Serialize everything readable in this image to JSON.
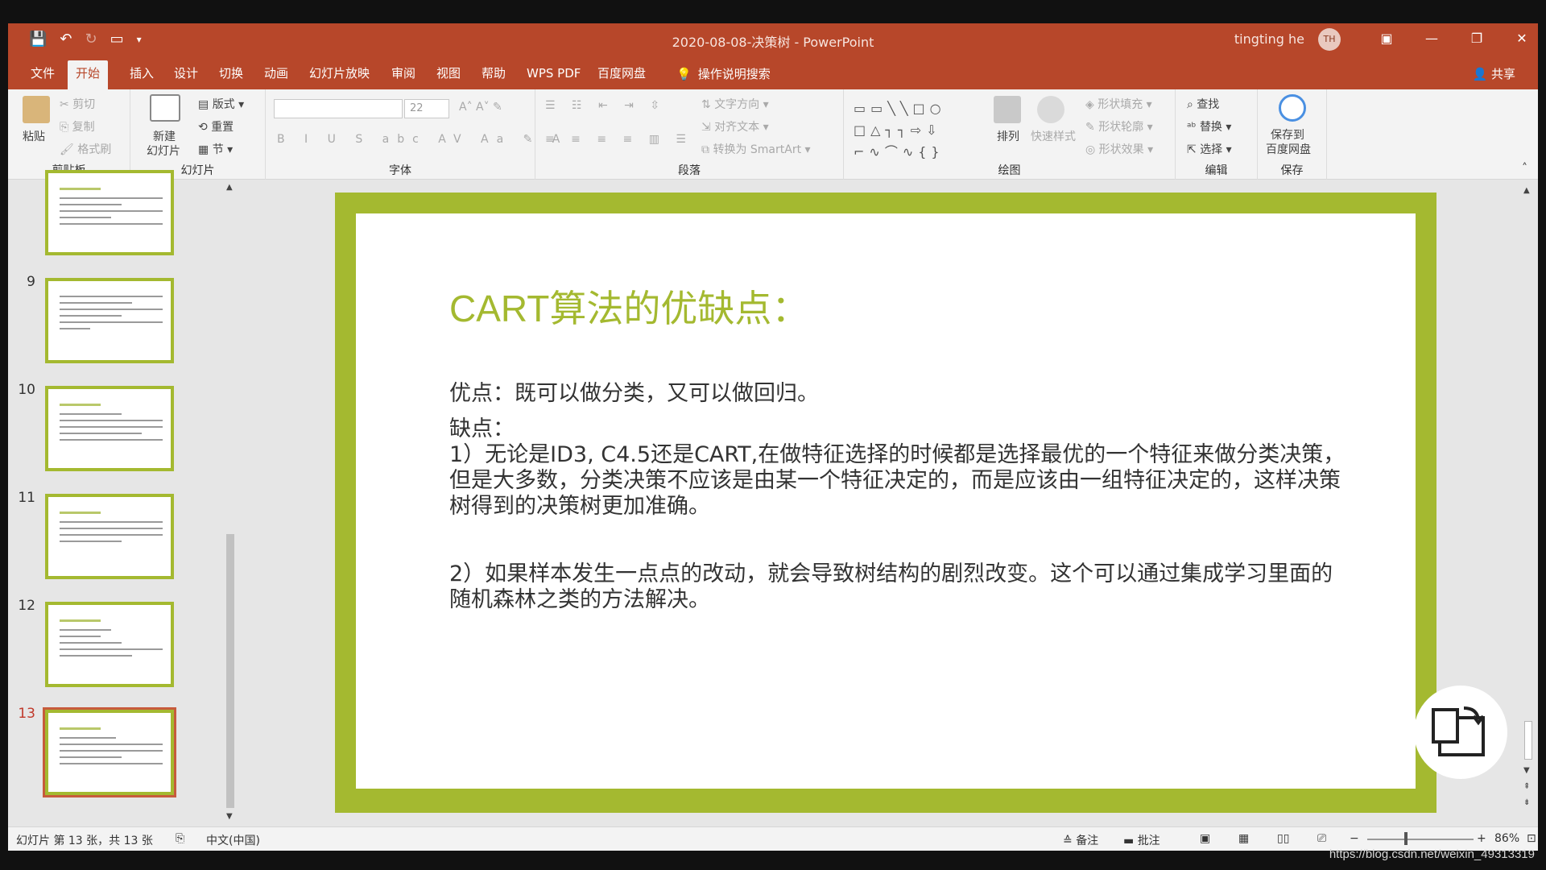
{
  "window": {
    "title": "2020-08-08-决策树 - PowerPoint",
    "user": "tingting he",
    "avatar_initials": "TH"
  },
  "tabs": [
    "文件",
    "开始",
    "插入",
    "设计",
    "切换",
    "动画",
    "幻灯片放映",
    "审阅",
    "视图",
    "帮助",
    "WPS PDF",
    "百度网盘"
  ],
  "active_tab": "开始",
  "tell_me": "操作说明搜索",
  "share": "共享",
  "ribbon": {
    "clipboard": {
      "label": "剪贴板",
      "paste": "粘贴",
      "cut": "剪切",
      "copy": "复制",
      "format_painter": "格式刷"
    },
    "slides": {
      "label": "幻灯片",
      "new_slide_1": "新建",
      "new_slide_2": "幻灯片",
      "layout": "版式",
      "reset": "重置",
      "section": "节"
    },
    "font": {
      "label": "字体",
      "size": "22"
    },
    "paragraph": {
      "label": "段落",
      "text_direction": "文字方向",
      "align_text": "对齐文本",
      "smartart": "转换为 SmartArt"
    },
    "drawing": {
      "label": "绘图",
      "arrange": "排列",
      "quick_styles": "快速样式",
      "shape_fill": "形状填充",
      "shape_outline": "形状轮廓",
      "shape_effects": "形状效果"
    },
    "editing": {
      "label": "编辑",
      "find": "查找",
      "replace": "替换",
      "select": "选择"
    },
    "save": {
      "label": "保存",
      "save_to_1": "保存到",
      "save_to_2": "百度网盘"
    }
  },
  "thumbnails": [
    {
      "num": "",
      "active": false
    },
    {
      "num": "9",
      "active": false
    },
    {
      "num": "10",
      "active": false
    },
    {
      "num": "11",
      "active": false
    },
    {
      "num": "12",
      "active": false
    },
    {
      "num": "13",
      "active": true
    }
  ],
  "slide": {
    "title": "CART算法的优缺点：",
    "pros": "优点：既可以做分类，又可以做回归。",
    "cons_heading": "缺点：",
    "cons_1": "1）无论是ID3, C4.5还是CART,在做特征选择的时候都是选择最优的一个特征来做分类决策，但是大多数，分类决策不应该是由某一个特征决定的，而是应该由一组特征决定的，这样决策树得到的决策树更加准确。",
    "cons_2": "2）如果样本发生一点点的改动，就会导致树结构的剧烈改变。这个可以通过集成学习里面的随机森林之类的方法解决。",
    "accent_color": "#a4b930"
  },
  "status": {
    "slide_info": "幻灯片 第 13 张，共 13 张",
    "language": "中文(中国)",
    "notes": "备注",
    "comments": "批注",
    "zoom": "86%"
  },
  "watermark": "https://blog.csdn.net/weixin_49313319"
}
